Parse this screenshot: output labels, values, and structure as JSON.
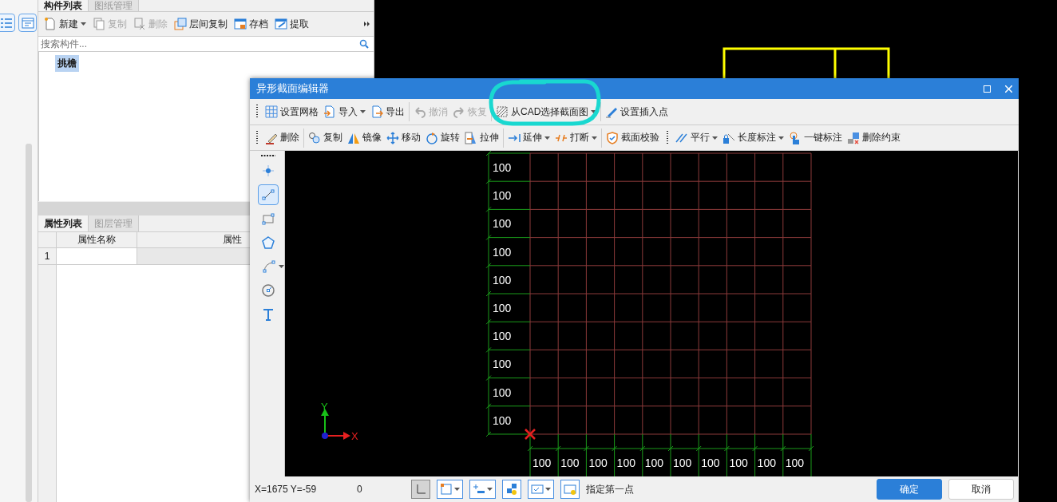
{
  "component_panel": {
    "tabs": [
      {
        "label": "构件列表",
        "selected": true
      },
      {
        "label": "图纸管理",
        "selected": false
      }
    ],
    "toolbar": [
      {
        "label": "新建",
        "disabled": false,
        "dropdown": true
      },
      {
        "label": "复制",
        "disabled": true,
        "dropdown": false
      },
      {
        "label": "删除",
        "disabled": true,
        "dropdown": false
      },
      {
        "label": "层间复制",
        "disabled": false,
        "dropdown": false
      },
      {
        "label": "存档",
        "disabled": false,
        "dropdown": false
      },
      {
        "label": "提取",
        "disabled": false,
        "dropdown": false
      }
    ],
    "search": {
      "placeholder": "搜索构件..."
    },
    "tree": [
      {
        "label": "挑檐",
        "selected": true
      }
    ]
  },
  "property_panel": {
    "tabs": [
      {
        "label": "属性列表",
        "selected": true
      },
      {
        "label": "图层管理",
        "selected": false
      }
    ],
    "columns": [
      "属性名称",
      "属性"
    ],
    "rows": [
      {
        "index": "1"
      }
    ]
  },
  "dialog": {
    "title": "异形截面编辑器",
    "toolbar_1": [
      [
        {
          "label": "设置网格",
          "disabled": false,
          "dropdown": false
        },
        {
          "label": "导入",
          "disabled": false,
          "dropdown": true
        },
        {
          "label": "导出",
          "disabled": false,
          "dropdown": false
        }
      ],
      [
        {
          "label": "撤消",
          "disabled": true,
          "dropdown": false
        },
        {
          "label": "恢复",
          "disabled": true,
          "dropdown": false
        }
      ],
      [
        {
          "label": "从CAD选择截面图",
          "disabled": false,
          "dropdown": true
        }
      ],
      [
        {
          "label": "设置插入点",
          "disabled": false,
          "dropdown": false
        }
      ]
    ],
    "toolbar_2": [
      [
        {
          "label": "删除",
          "disabled": false,
          "dropdown": false
        }
      ],
      [
        {
          "label": "复制",
          "disabled": false,
          "dropdown": false
        },
        {
          "label": "镜像",
          "disabled": false,
          "dropdown": false
        },
        {
          "label": "移动",
          "disabled": false,
          "dropdown": false
        },
        {
          "label": "旋转",
          "disabled": false,
          "dropdown": false
        },
        {
          "label": "拉伸",
          "disabled": false,
          "dropdown": false
        }
      ],
      [
        {
          "label": "延伸",
          "disabled": false,
          "dropdown": true
        },
        {
          "label": "打断",
          "disabled": false,
          "dropdown": true
        }
      ],
      [
        {
          "label": "截面校验",
          "disabled": false,
          "dropdown": false
        }
      ]
    ],
    "toolbar_3": [
      [
        {
          "label": "平行",
          "disabled": false,
          "dropdown": true
        },
        {
          "label": "长度标注",
          "disabled": false,
          "dropdown": true
        },
        {
          "label": "一键标注",
          "disabled": false,
          "dropdown": false
        },
        {
          "label": "删除约束",
          "disabled": false,
          "dropdown": false
        }
      ]
    ],
    "tools": [
      {
        "selected": false,
        "dropdown": false
      },
      {
        "selected": true,
        "dropdown": false
      },
      {
        "selected": false,
        "dropdown": false
      },
      {
        "selected": false,
        "dropdown": false
      },
      {
        "selected": false,
        "dropdown": true
      },
      {
        "selected": false,
        "dropdown": false
      },
      {
        "selected": false,
        "dropdown": false
      }
    ],
    "grid": {
      "row_dims": [
        "100",
        "100",
        "100",
        "100",
        "100",
        "100",
        "100",
        "100",
        "100",
        "100"
      ],
      "col_dims": [
        "100",
        "100",
        "100",
        "100",
        "100",
        "100",
        "100",
        "100",
        "100",
        "100"
      ],
      "axes": {
        "x": "X",
        "y": "Y"
      }
    },
    "status_bar": {
      "coordinates": "X=1675 Y=-59",
      "value": "0",
      "tools": [
        {
          "selected": true,
          "dropdown": false
        },
        {
          "selected": false,
          "dropdown": true
        },
        {
          "selected": false,
          "dropdown": true
        },
        {
          "selected": false,
          "dropdown": false
        },
        {
          "selected": false,
          "dropdown": true
        },
        {
          "selected": false,
          "dropdown": false
        }
      ],
      "prompt": "指定第一点"
    },
    "buttons": [
      {
        "label": "确定",
        "primary": true
      },
      {
        "label": "取消",
        "primary": false
      }
    ]
  }
}
